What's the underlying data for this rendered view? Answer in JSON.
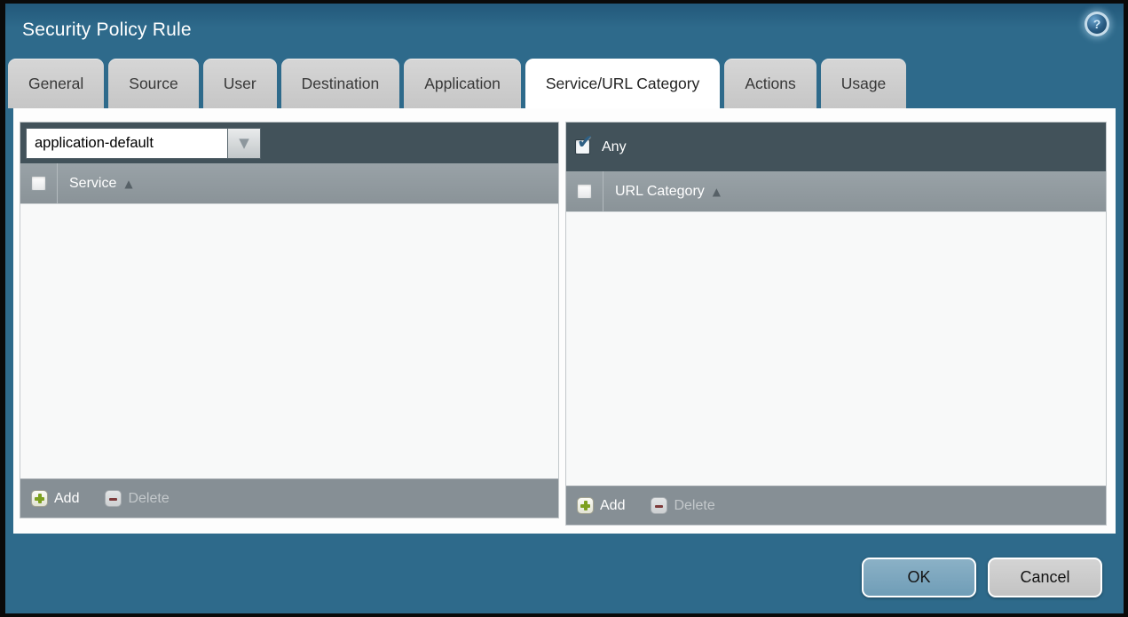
{
  "window": {
    "title": "Security Policy Rule"
  },
  "icons": {
    "help": "?",
    "sort_asc": "▲",
    "dropdown_arrow": "▼",
    "check": "✔"
  },
  "tabs": [
    {
      "label": "General",
      "active": false
    },
    {
      "label": "Source",
      "active": false
    },
    {
      "label": "User",
      "active": false
    },
    {
      "label": "Destination",
      "active": false
    },
    {
      "label": "Application",
      "active": false
    },
    {
      "label": "Service/URL Category",
      "active": true
    },
    {
      "label": "Actions",
      "active": false
    },
    {
      "label": "Usage",
      "active": false
    }
  ],
  "service_panel": {
    "dropdown": {
      "value": "application-default"
    },
    "header": {
      "label": "Service",
      "checkbox_checked": false
    },
    "rows": [],
    "footer": {
      "add_label": "Add",
      "delete_label": "Delete",
      "delete_enabled": false
    }
  },
  "url_category_panel": {
    "any_label": "Any",
    "any_checked": true,
    "header": {
      "label": "URL Category",
      "checkbox_checked": false
    },
    "rows": [],
    "footer": {
      "add_label": "Add",
      "delete_label": "Delete",
      "delete_enabled": false
    }
  },
  "dialog_buttons": {
    "ok": "OK",
    "cancel": "Cancel"
  },
  "colors": {
    "titlebar_teal": "#2e6a8b",
    "tab_inactive_gray": "#cccccc",
    "active_tab_white": "#ffffff",
    "panel_topbar_slate": "#42525a",
    "header_row_gray": "#8f989d",
    "footer_row_gray": "#868f95",
    "ok_button_blue": "#7ca6bf",
    "cancel_button_gray": "#c9c9c9",
    "add_icon_green": "#7da01e",
    "delete_icon_maroon": "#7d3b3b",
    "checkmark_blue": "#2d5f84"
  }
}
